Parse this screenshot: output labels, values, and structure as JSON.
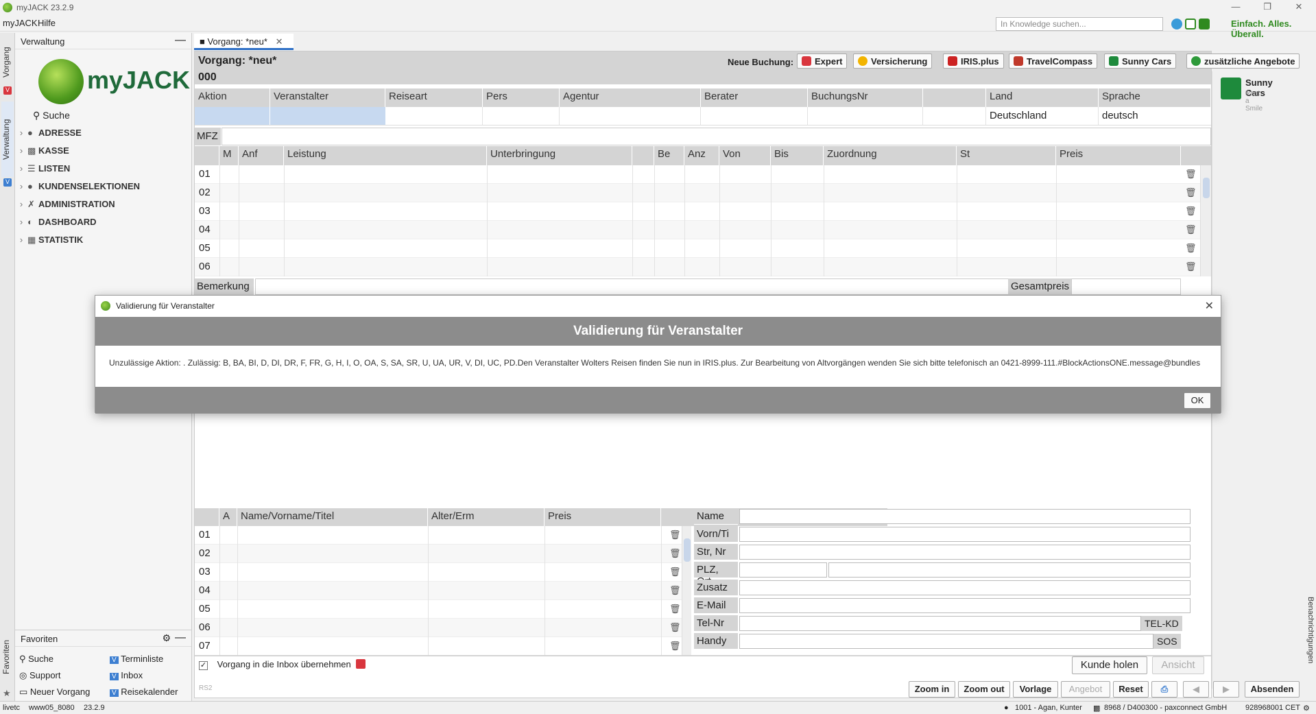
{
  "window": {
    "title": "myJACK 23.2.9"
  },
  "menu": {
    "items": [
      "myJACK",
      "Hilfe"
    ]
  },
  "toolbar": {
    "search_placeholder": "In Knowledge suchen...",
    "slogan": "Einfach. Alles. Überall."
  },
  "vtabs": {
    "vorgang": "Vorgang",
    "verwaltung": "Verwaltung",
    "favoriten": "Favoriten"
  },
  "sidebar": {
    "title": "Verwaltung",
    "logo_text": "myJACK",
    "search": "Suche",
    "items": [
      {
        "label": "ADRESSE",
        "icon": "person-icon"
      },
      {
        "label": "KASSE",
        "icon": "cash-register-icon"
      },
      {
        "label": "LISTEN",
        "icon": "list-icon"
      },
      {
        "label": "KUNDENSELEKTIONEN",
        "icon": "person-search-icon"
      },
      {
        "label": "ADMINISTRATION",
        "icon": "wrench-icon"
      },
      {
        "label": "DASHBOARD",
        "icon": "dashboard-icon"
      },
      {
        "label": "STATISTIK",
        "icon": "chart-icon"
      }
    ]
  },
  "favorites": {
    "title": "Favoriten",
    "items": [
      "Suche",
      "Support",
      "Neuer Vorgang",
      "Terminliste",
      "Inbox",
      "Reisekalender"
    ]
  },
  "doc_tab": {
    "label": "Vorgang: *neu*"
  },
  "booking": {
    "heading": "Vorgang: *neu*",
    "number": "000",
    "new_booking_label": "Neue Buchung:",
    "buttons": [
      "Expert",
      "Versicherung",
      "IRIS.plus",
      "TravelCompass",
      "Sunny Cars",
      "zusätzliche Angebote"
    ],
    "colors": {
      "expert": "#d9363e",
      "versicherung": "#f2b400",
      "iris": "#cc2222",
      "travelcompass": "#c0392b",
      "sunnycars": "#1e8a3c",
      "zusatz": "#2e9a3a"
    }
  },
  "ad": {
    "title": "Sunny Cars",
    "subtitle": "Rent a Smile"
  },
  "header_table": {
    "columns": [
      "Aktion",
      "Veranstalter",
      "Reiseart",
      "Pers",
      "Agentur",
      "Berater",
      "BuchungsNr",
      "",
      "Land",
      "Sprache"
    ],
    "values": [
      "",
      "",
      "",
      "",
      "",
      "",
      "",
      "",
      "Deutschland",
      "deutsch"
    ],
    "mfz_label": "MFZ"
  },
  "services_table": {
    "columns": [
      "M",
      "Anf",
      "Leistung",
      "Unterbringung",
      "",
      "Be",
      "Anz",
      "Von",
      "Bis",
      "Zuordnung",
      "St",
      "Preis"
    ],
    "rows": [
      "01",
      "02",
      "03",
      "04",
      "05",
      "06"
    ]
  },
  "remarks": {
    "label": "Bemerkung",
    "total_label": "Gesamtpreis"
  },
  "dialog": {
    "window_title": "Validierung für Veranstalter",
    "heading": "Validierung für Veranstalter",
    "message": "Unzulässige Aktion: . Zulässig: B, BA, BI, D, DI, DR, F, FR, G, H, I, O, OA, S, SA, SR, U, UA, UR, V, DI, UC, PD.Den Veranstalter Wolters Reisen finden Sie nun in IRIS.plus. Zur Bearbeitung von Altvorgängen wenden Sie sich bitte telefonisch an 0421-8999-111.#BlockActionsONE.message@bundles",
    "ok": "OK"
  },
  "travelers_table": {
    "columns": [
      "A",
      "Name/Vorname/Titel",
      "Alter/Erm",
      "Preis"
    ],
    "rows": [
      "01",
      "02",
      "03",
      "04",
      "05",
      "06",
      "07"
    ]
  },
  "customer_form": {
    "labels": [
      "Name",
      "Vorn/Ti",
      "Str, Nr",
      "PLZ, Ort",
      "Zusatz",
      "E-Mail",
      "Tel-Nr",
      "Handy"
    ],
    "tel_tag": "TEL-KD",
    "handy_tag": "SOS",
    "kunde_holen": "Kunde holen",
    "ansicht": "Ansicht"
  },
  "inbox_checkbox": {
    "label": "Vorgang in die Inbox übernehmen",
    "checked": true
  },
  "footer_code": "RS2",
  "bottom_buttons": [
    "Zoom in",
    "Zoom out",
    "Vorlage",
    "Angebot",
    "Reset",
    "Absenden"
  ],
  "notifications_label": "Benachrichtigungen",
  "status": {
    "left1": "livetc",
    "left2": "www05_8080",
    "left3": "23.2.9",
    "user": "1001 - Agan, Kunter",
    "agency": "8968 / D400300 - paxconnect GmbH",
    "code": "928968001",
    "tz": "CET"
  }
}
